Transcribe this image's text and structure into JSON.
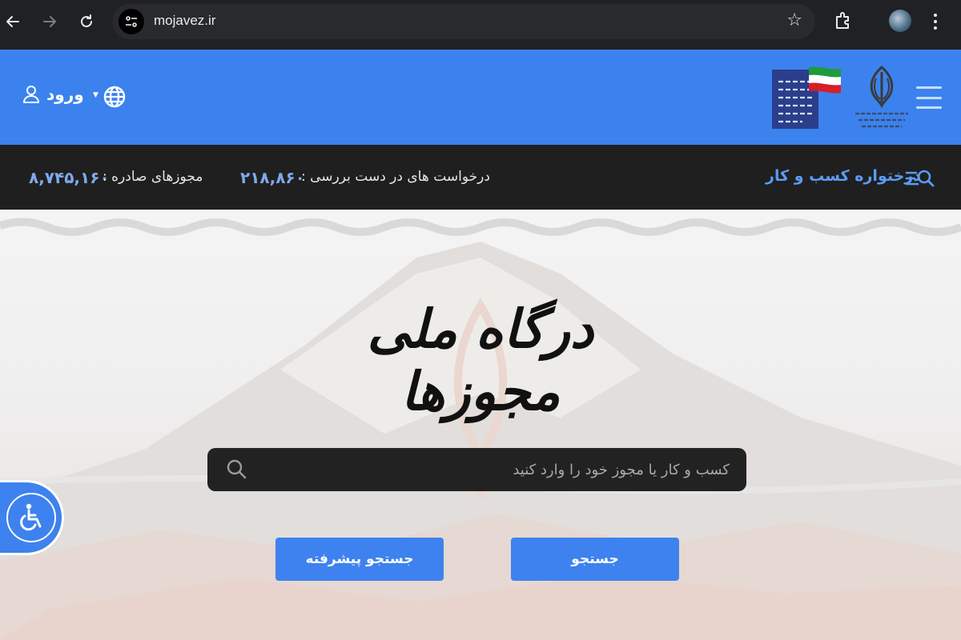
{
  "browser": {
    "url": "mojavez.ir",
    "icons": [
      "back-icon",
      "forward-icon",
      "reload-icon",
      "site-info-icon",
      "bookmark-star-icon",
      "extensions-icon",
      "profile-avatar",
      "menu-kebab-icon"
    ]
  },
  "header": {
    "login_label": "ورود",
    "language_icon": "globe-icon",
    "menu_icon": "hamburger-icon",
    "brand_color": "#3b82ee"
  },
  "stats": {
    "issued_label": "مجوزهای صادره :",
    "issued_value": "۸,۷۴۵,۱۶۰",
    "pending_label": "درخواست های در دست بررسی :",
    "pending_value": "۲۱۸,۸۶۰",
    "apply_link": "درختواره کسب و کار"
  },
  "hero": {
    "title": "درگاه ملی مجوزها",
    "search_placeholder": "کسب و کار یا مجوز خود را وارد کنید",
    "search_button": "جستجو",
    "advanced_search_button": "جستجو پیشرفته"
  },
  "accessibility": {
    "icon": "wheelchair-icon"
  }
}
